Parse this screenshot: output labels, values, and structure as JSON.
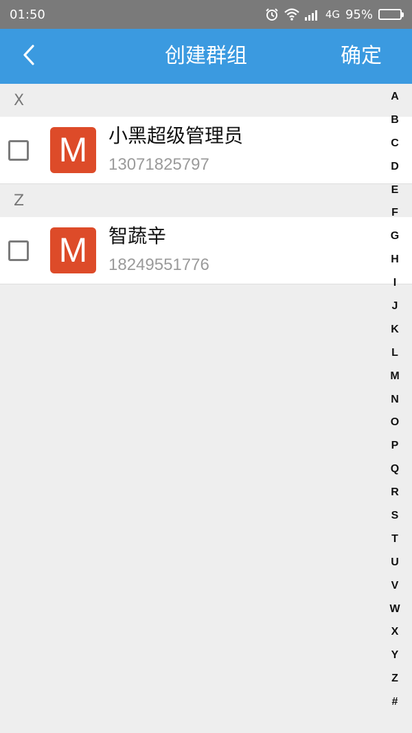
{
  "status_bar": {
    "time": "01:50",
    "network_type": "4G",
    "battery_percent": "95%",
    "battery_level": 0.95,
    "icons": [
      "alarm-icon",
      "wifi-icon",
      "signal-icon",
      "battery-icon"
    ]
  },
  "app_bar": {
    "title": "创建群组",
    "confirm_label": "确定",
    "back_icon": "chevron-left-icon",
    "background_color": "#3b9ae0"
  },
  "sections": [
    {
      "letter": "X",
      "contacts": [
        {
          "avatar_letter": "M",
          "name": "小黑超级管理员",
          "phone": "13071825797",
          "checked": false
        }
      ]
    },
    {
      "letter": "Z",
      "contacts": [
        {
          "avatar_letter": "M",
          "name": "智蔬辛",
          "phone": "18249551776",
          "checked": false
        }
      ]
    }
  ],
  "index_letters": [
    "A",
    "B",
    "C",
    "D",
    "E",
    "F",
    "G",
    "H",
    "I",
    "J",
    "K",
    "L",
    "M",
    "N",
    "O",
    "P",
    "Q",
    "R",
    "S",
    "T",
    "U",
    "V",
    "W",
    "X",
    "Y",
    "Z",
    "#"
  ],
  "colors": {
    "avatar": "#dd4b29",
    "status_bar": "#7a7a7a"
  }
}
